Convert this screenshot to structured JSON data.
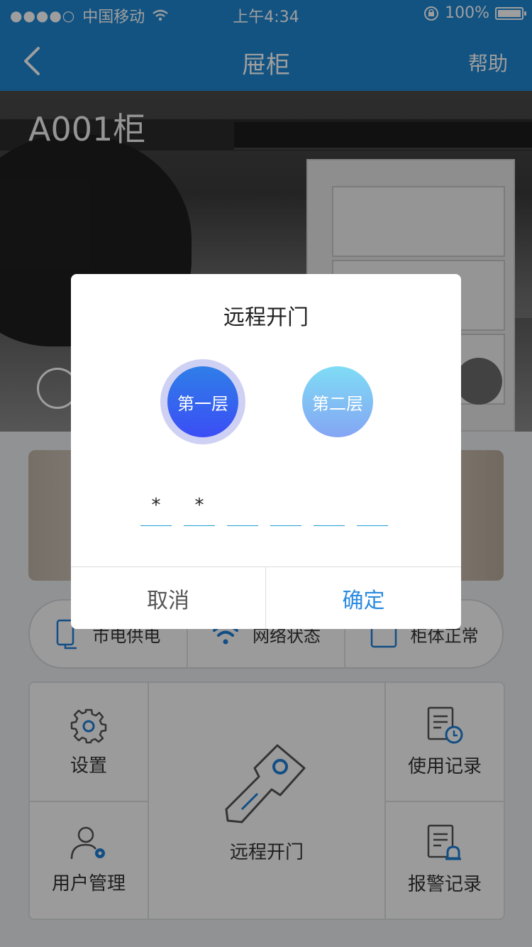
{
  "status_bar": {
    "carrier": "中国移动",
    "time": "上午4:34",
    "battery": "100%"
  },
  "nav": {
    "title": "屉柜",
    "help": "帮助"
  },
  "hero": {
    "title": "A001柜"
  },
  "status_row": {
    "items": [
      {
        "label": "市电供电",
        "icon": "power-device-icon"
      },
      {
        "label": "网络状态",
        "icon": "wifi-icon"
      },
      {
        "label": "柜体正常",
        "icon": "cabinet-icon"
      }
    ]
  },
  "menu": {
    "settings": "设置",
    "users": "用户管理",
    "remote": "远程开门",
    "usage": "使用记录",
    "alarm": "报警记录"
  },
  "dialog": {
    "title": "远程开门",
    "layers": [
      "第一层",
      "第二层"
    ],
    "selected_layer": "第一层",
    "pin": [
      "*",
      "*",
      "",
      "",
      "",
      ""
    ],
    "cancel": "取消",
    "confirm": "确定"
  },
  "colors": {
    "primary": "#1e86d2",
    "confirm": "#2b8be0",
    "icon_accent": "#1e7fd6"
  }
}
